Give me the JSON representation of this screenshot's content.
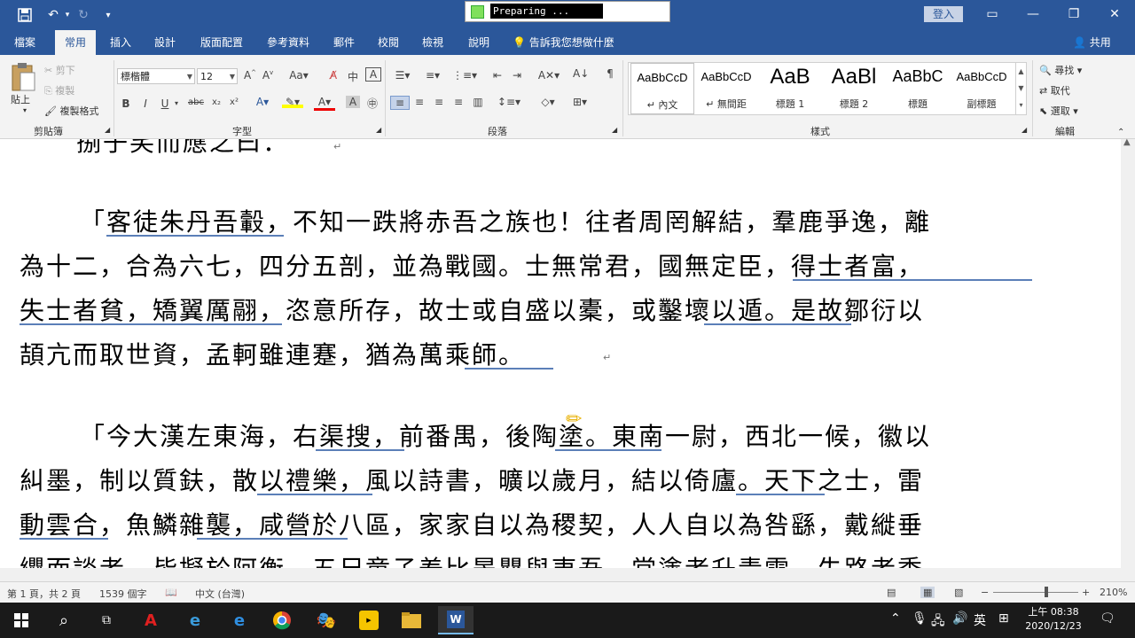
{
  "titlebar": {
    "preparing_text": "Preparing ...",
    "signin": "登入",
    "qat_more": "▾"
  },
  "tabs": [
    "檔案",
    "常用",
    "插入",
    "設計",
    "版面配置",
    "參考資料",
    "郵件",
    "校閱",
    "檢視",
    "說明"
  ],
  "active_tab": "常用",
  "tell_me": "告訴我您想做什麼",
  "share": "共用",
  "ribbon": {
    "clipboard": {
      "paste": "貼上",
      "cut": "剪下",
      "copy": "複製",
      "format_painter": "複製格式",
      "label": "剪貼簿"
    },
    "font": {
      "name": "標楷體",
      "size": "12",
      "label": "字型"
    },
    "paragraph": {
      "label": "段落"
    },
    "styles": {
      "label": "樣式",
      "items": [
        {
          "preview": "AaBbCcD",
          "name": "↵ 內文"
        },
        {
          "preview": "AaBbCcD",
          "name": "↵ 無間距"
        },
        {
          "preview": "AaB",
          "name": "標題 1"
        },
        {
          "preview": "AaBl",
          "name": "標題 2"
        },
        {
          "preview": "AaBbC",
          "name": "標題"
        },
        {
          "preview": "AaBbCcD",
          "name": "副標題"
        }
      ]
    },
    "editing": {
      "find": "尋找",
      "replace": "取代",
      "select": "選取",
      "label": "編輯"
    }
  },
  "document": {
    "lines": [
      "捌子笑而應之曰：",
      "「客徒朱丹吾轂，不知一跌將赤吾之族也！往者周罔解結，羣鹿爭逸，離",
      "為十二，合為六七，四分五剖，並為戰國。士無常君，國無定臣，得士者富，",
      "失士者貧，矯翼厲翮，恣意所存，故士或自盛以橐，或鑿壞以遁。是故鄒衍以",
      "頡亢而取世資，孟軻雖連蹇，猶為萬乘師。",
      "「今大漢左東海，右渠搜，前番禺，後陶塗。東南一尉，西北一候，徽以",
      "糾墨，制以質鈇，散以禮樂，風以詩書，曠以歲月，結以倚廬。天下之士，雷",
      "動雲合，魚鱗雜襲，咸營於八區，家家自以為稷契，人人自以為咎繇，戴縰垂",
      "纓而談者，皆擬於阿衡，五尺童子羞比晏嬰與夷吾。當塗者升青雲，失路者委"
    ]
  },
  "status": {
    "page": "第 1 頁，共 2 頁",
    "words": "1539 個字",
    "language": "中文 (台灣)",
    "zoom": "210%",
    "zoom_minus": "−",
    "zoom_plus": "+"
  },
  "taskbar": {
    "ime": "英",
    "time": "上午 08:38",
    "date": "2020/12/23"
  },
  "colors": {
    "brand": "#2b579a",
    "taskbar": "#1a1a1a"
  }
}
